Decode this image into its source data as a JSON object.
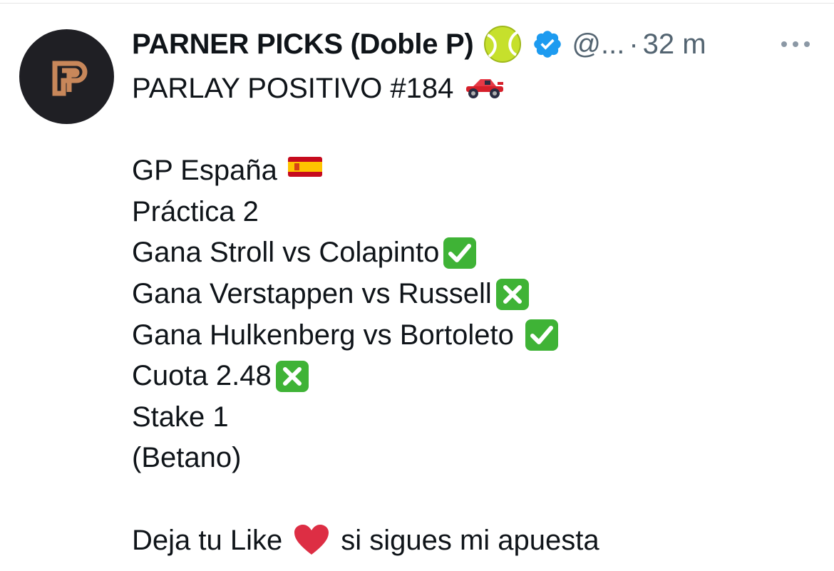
{
  "tweet": {
    "display_name": "PARNER PICKS (Doble P)",
    "handle": "@...",
    "separator": "·",
    "time": "32 m",
    "icons": {
      "tennis": "tennis-ball-emoji",
      "verified": "verified-badge-icon",
      "more": "more-dots-icon",
      "car": "racing-car-emoji",
      "flag": "spain-flag-emoji",
      "check": "check-mark-button-emoji",
      "cross": "cross-mark-button-emoji",
      "heart": "red-heart-emoji"
    },
    "lines": [
      "PARLAY POSITIVO #184",
      "",
      "GP España",
      "Práctica 2",
      "Gana Stroll vs Colapinto",
      "Gana Verstappen vs Russell",
      "Gana Hulkenberg vs Bortoleto",
      "Cuota 2.48",
      "Stake 1",
      "(Betano)",
      "",
      "Deja tu Like",
      "si sigues mi apuesta"
    ]
  },
  "colors": {
    "verified": "#1d9bf0",
    "secondary_text": "#536471",
    "check_green": "#3fb336",
    "avatar_bg": "#1f1f24",
    "avatar_logo": "#c8875a"
  }
}
